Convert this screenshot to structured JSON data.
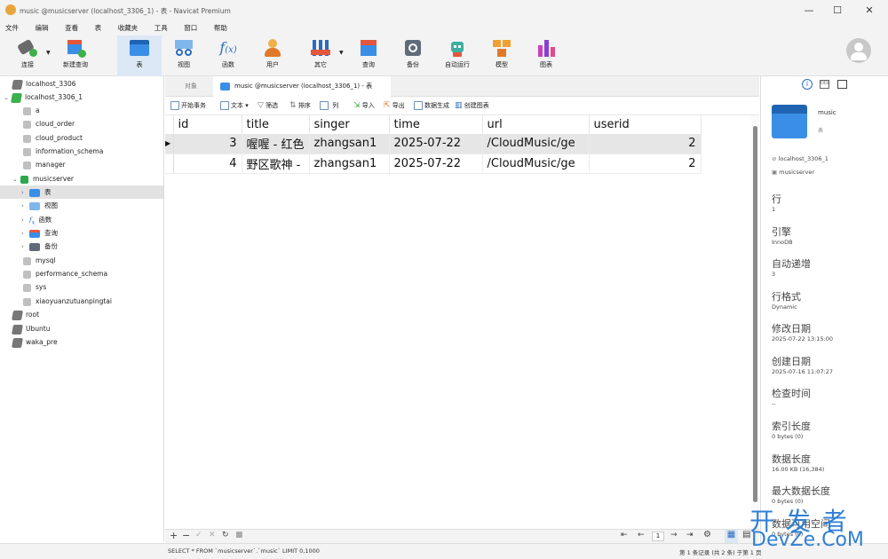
{
  "window": {
    "title": "music @musicserver (localhost_3306_1) - 表 - Navicat Premium"
  },
  "menu": [
    "文件",
    "编辑",
    "查看",
    "表",
    "收藏夹",
    "工具",
    "窗口",
    "帮助"
  ],
  "toolbar": {
    "connect": "连接",
    "new_query": "新建查询",
    "table": "表",
    "view": "视图",
    "function": "函数",
    "user": "用户",
    "other": "其它",
    "query": "查询",
    "backup": "备份",
    "automation": "自动运行",
    "model": "模型",
    "chart": "图表"
  },
  "sidebar": {
    "items": [
      {
        "label": "localhost_3306"
      },
      {
        "label": "localhost_3306_1"
      },
      {
        "label": "a"
      },
      {
        "label": "cloud_order"
      },
      {
        "label": "cloud_product"
      },
      {
        "label": "information_schema"
      },
      {
        "label": "manager"
      },
      {
        "label": "musicserver"
      },
      {
        "label": "表"
      },
      {
        "label": "视图"
      },
      {
        "label": "函数"
      },
      {
        "label": "查询"
      },
      {
        "label": "备份"
      },
      {
        "label": "mysql"
      },
      {
        "label": "performance_schema"
      },
      {
        "label": "sys"
      },
      {
        "label": "xiaoyuanzutuanpingtai"
      },
      {
        "label": "root"
      },
      {
        "label": "Ubuntu"
      },
      {
        "label": "waka_pre"
      }
    ]
  },
  "tabs": {
    "objects": "对象",
    "active": "music @musicserver (localhost_3306_1) - 表"
  },
  "grid_toolbar": {
    "begin_transaction": "开始事务",
    "text": "文本",
    "filter": "筛选",
    "sort": "排序",
    "columns": "列",
    "import": "导入",
    "export": "导出",
    "data_generation": "数据生成",
    "create_chart": "创建图表"
  },
  "table": {
    "columns": [
      "id",
      "title",
      "singer",
      "time",
      "url",
      "userid"
    ],
    "rows": [
      {
        "id": "3",
        "title": "喔喔 - 红色",
        "singer": "zhangsan1",
        "time": "2025-07-22",
        "url": "/CloudMusic/ge",
        "userid": "2"
      },
      {
        "id": "4",
        "title": "野区歌神 -",
        "singer": "zhangsan1",
        "time": "2025-07-22",
        "url": "/CloudMusic/ge",
        "userid": "2"
      }
    ]
  },
  "pagination": {
    "page": "1"
  },
  "status": {
    "sql": "SELECT * FROM `musicserver`.`music` LIMIT 0,1000",
    "records": "第 1 条记录 (共 2 条) 于第 1 页"
  },
  "info_panel": {
    "name": "music",
    "type": "表",
    "connection": "localhost_3306_1",
    "database": "musicserver",
    "fields": [
      {
        "label": "行",
        "value": "1"
      },
      {
        "label": "引擎",
        "value": "InnoDB"
      },
      {
        "label": "自动递增",
        "value": "3"
      },
      {
        "label": "行格式",
        "value": "Dynamic"
      },
      {
        "label": "修改日期",
        "value": "2025-07-22 13:15:00"
      },
      {
        "label": "创建日期",
        "value": "2025-07-16 11:07:27"
      },
      {
        "label": "检查时间",
        "value": "--"
      },
      {
        "label": "索引长度",
        "value": "0 bytes (0)"
      },
      {
        "label": "数据长度",
        "value": "16.00 KB (16,384)"
      },
      {
        "label": "最大数据长度",
        "value": "0 bytes (0)"
      },
      {
        "label": "数据可用空间",
        "value": "0 bytes (0)"
      }
    ]
  },
  "watermark": {
    "line1": "开 发 者",
    "line2": "DevZe.CoM"
  },
  "colors": {
    "accent_blue": "#2f7fd6",
    "selected_row": "#e6e6e6",
    "toolbar_bg": "#f3f3f3"
  }
}
